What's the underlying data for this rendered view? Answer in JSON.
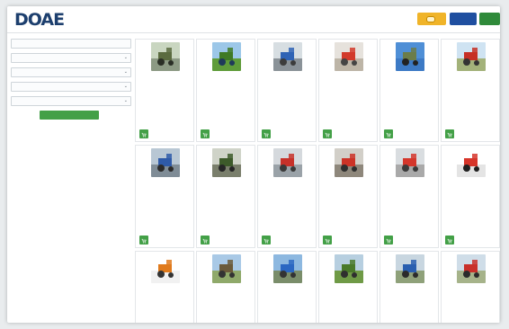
{
  "header": {
    "logo_text": "DOAE",
    "site_title": "",
    "login_label": "",
    "register_label": ""
  },
  "sidebar": {
    "filters": [
      {
        "label": "",
        "has_chevron": false
      },
      {
        "label": "",
        "has_chevron": true
      },
      {
        "label": "",
        "has_chevron": true
      },
      {
        "label": "",
        "has_chevron": true
      },
      {
        "label": "",
        "has_chevron": true
      }
    ],
    "search_label": ""
  },
  "icons": {
    "cart": "cart-icon",
    "chevron": "chevron-down-icon"
  },
  "colors": {
    "accent_green": "#43a047",
    "brand_blue": "#1f4fa0",
    "login_yellow": "#f0b429"
  },
  "cards": [
    {
      "title": "",
      "desc": "",
      "province": "",
      "code": "",
      "price": "",
      "image": "tractor-yard"
    },
    {
      "title": "",
      "desc": "",
      "province": "",
      "code": "",
      "price": "",
      "image": "tractor-field"
    },
    {
      "title": "",
      "desc": "",
      "province": "",
      "code": "",
      "price": "",
      "image": "blue-machine"
    },
    {
      "title": "",
      "desc": "",
      "province": "",
      "code": "",
      "price": "",
      "image": "red-implement"
    },
    {
      "title": "",
      "desc": "",
      "province": "",
      "code": "",
      "price": "",
      "image": "blue-sky-tractor"
    },
    {
      "title": "",
      "desc": "",
      "province": "",
      "code": "",
      "price": "",
      "image": "red-tractor"
    },
    {
      "title": "",
      "desc": "",
      "province": "",
      "code": "",
      "price": "",
      "image": "tractor-road"
    },
    {
      "title": "",
      "desc": "",
      "province": "",
      "code": "",
      "price": "",
      "image": "barn-machine"
    },
    {
      "title": "",
      "desc": "",
      "province": "",
      "code": "",
      "price": "",
      "image": "red-harvester"
    },
    {
      "title": "",
      "desc": "",
      "province": "",
      "code": "",
      "price": "",
      "image": "red-tractor-shed"
    },
    {
      "title": "",
      "desc": "",
      "province": "",
      "code": "",
      "price": "",
      "image": "red-cab-tractor"
    },
    {
      "title": "",
      "desc": "",
      "province": "",
      "code": "",
      "price": "",
      "image": "combine-harvester"
    },
    {
      "title": "",
      "desc": "",
      "image": "orange-walker"
    },
    {
      "title": "",
      "desc": "",
      "image": "field-trailer"
    },
    {
      "title": "",
      "desc": "",
      "image": "blue-shed"
    },
    {
      "title": "",
      "desc": "",
      "image": "green-field"
    },
    {
      "title": "",
      "desc": "",
      "image": "blue-tractor"
    },
    {
      "title": "",
      "desc": "",
      "image": "red-tractor-2"
    }
  ]
}
